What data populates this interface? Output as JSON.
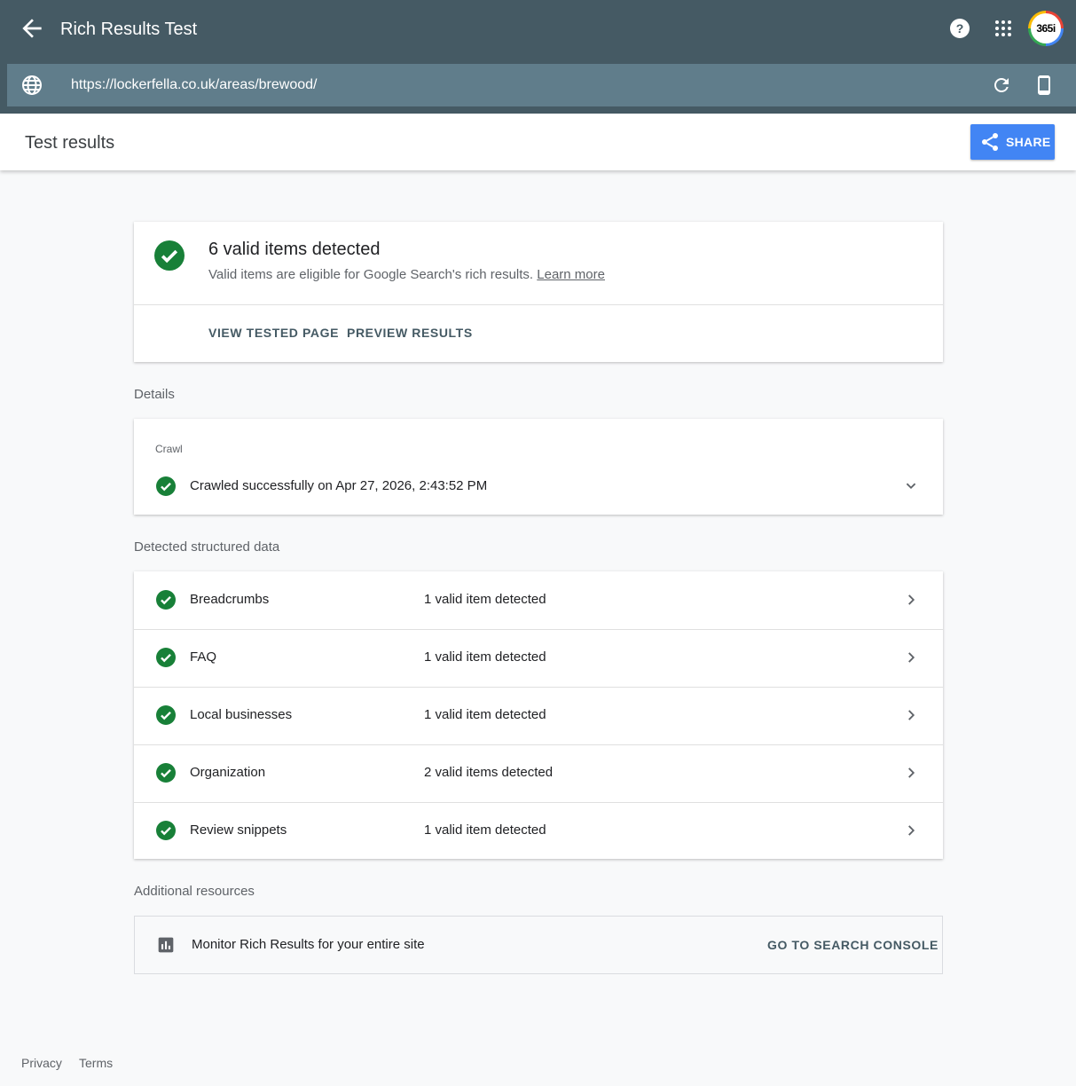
{
  "app": {
    "title": "Rich Results Test",
    "avatar_text": "365i"
  },
  "urlbar": {
    "url": "https://lockerfella.co.uk/areas/brewood/"
  },
  "header": {
    "title": "Test results",
    "share_label": "SHARE"
  },
  "summary": {
    "title": "6 valid items detected",
    "subtitle": "Valid items are eligible for Google Search's rich results.",
    "learn_more": "Learn more",
    "view_tested_page": "VIEW TESTED PAGE",
    "preview_results": "PREVIEW RESULTS"
  },
  "details": {
    "section_label": "Details",
    "crawl_label": "Crawl",
    "crawl_status": "Crawled successfully on Apr 27, 2026, 2:43:52 PM"
  },
  "structured": {
    "section_label": "Detected structured data",
    "items": [
      {
        "name": "Breadcrumbs",
        "count": "1 valid item detected"
      },
      {
        "name": "FAQ",
        "count": "1 valid item detected"
      },
      {
        "name": "Local businesses",
        "count": "1 valid item detected"
      },
      {
        "name": "Organization",
        "count": "2 valid items detected"
      },
      {
        "name": "Review snippets",
        "count": "1 valid item detected"
      }
    ]
  },
  "resources": {
    "section_label": "Additional resources",
    "text": "Monitor Rich Results for your entire site",
    "button": "GO TO SEARCH CONSOLE"
  },
  "footer": {
    "privacy": "Privacy",
    "terms": "Terms"
  },
  "colors": {
    "topbar": "#455a64",
    "urlbar": "#607d8b",
    "accent": "#4285f4",
    "success": "#188038"
  }
}
